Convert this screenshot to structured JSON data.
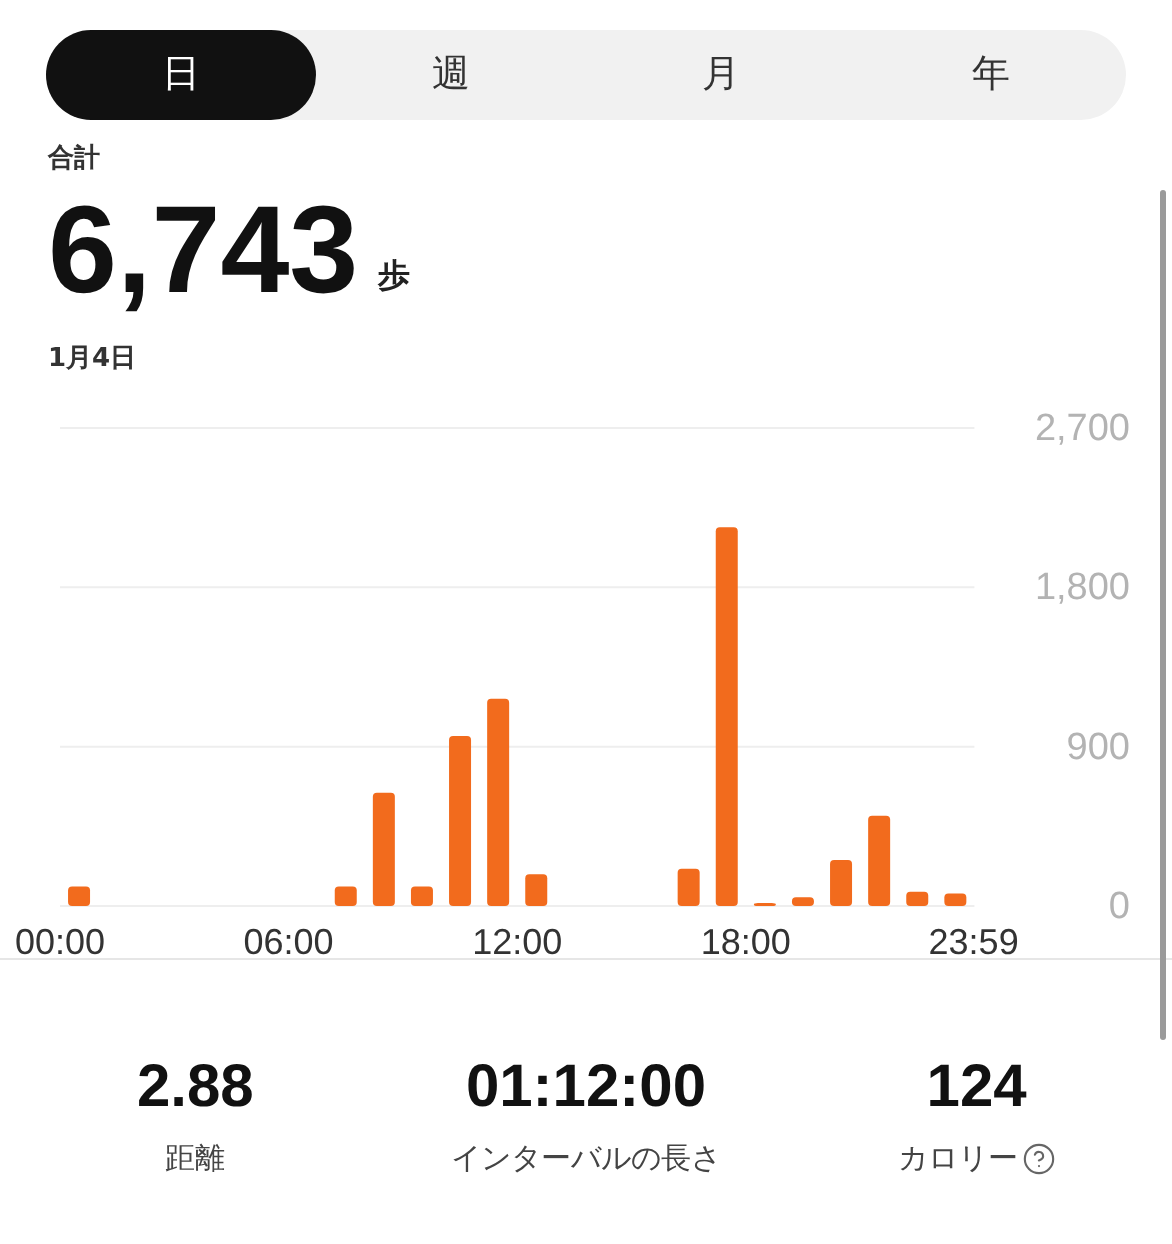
{
  "tabs": [
    {
      "label": "日",
      "selected": true
    },
    {
      "label": "週",
      "selected": false
    },
    {
      "label": "月",
      "selected": false
    },
    {
      "label": "年",
      "selected": false
    }
  ],
  "summary": {
    "label": "合計",
    "value": "6,743",
    "unit": "歩",
    "date": "1月4日"
  },
  "chart_data": {
    "type": "bar",
    "x": [
      0.5,
      7.5,
      8.5,
      9.5,
      10.5,
      11.5,
      12.5,
      16.5,
      17.5,
      18.5,
      19.5,
      20.5,
      21.5,
      22.5,
      23.5
    ],
    "xlim": [
      0,
      24
    ],
    "series": [
      {
        "color": "#f26b1d",
        "values": [
          110,
          110,
          640,
          110,
          960,
          1170,
          180,
          210,
          2140,
          10,
          50,
          260,
          510,
          80,
          70
        ]
      }
    ],
    "ylim": [
      0,
      2700
    ],
    "yticks": [
      0,
      {
        "value": 900,
        "label": "900"
      },
      {
        "value": 1800,
        "label": "1,800"
      },
      {
        "value": 2700,
        "label": "2,700"
      }
    ],
    "xticks": [
      {
        "value": 0,
        "label": "00:00"
      },
      {
        "value": 6,
        "label": "06:00"
      },
      {
        "value": 12,
        "label": "12:00"
      },
      {
        "value": 18,
        "label": "18:00"
      },
      {
        "value": 23.98,
        "label": "23:59"
      }
    ]
  },
  "stats": [
    {
      "value": "2.88",
      "label": "距離",
      "help": false
    },
    {
      "value": "01:12:00",
      "label": "インターバルの長さ",
      "help": false
    },
    {
      "value": "124",
      "label": "カロリー",
      "help": true
    }
  ]
}
